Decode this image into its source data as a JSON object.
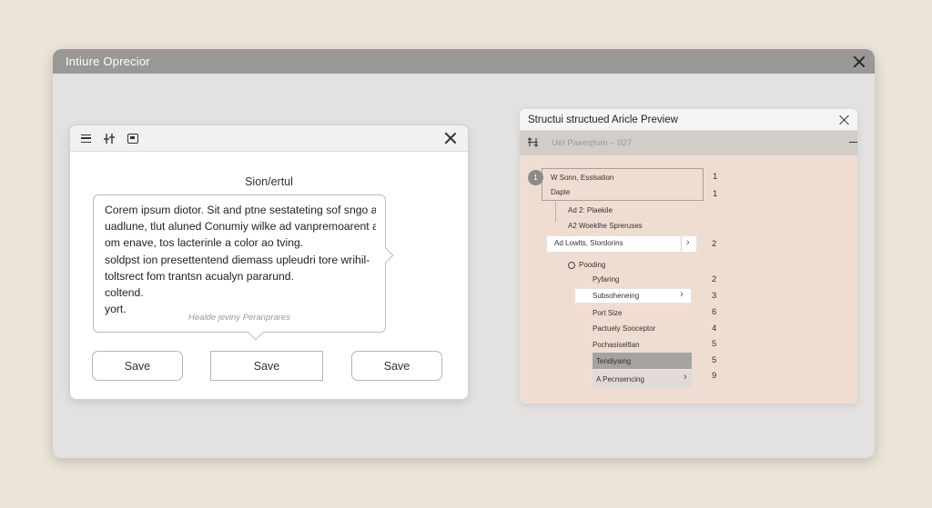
{
  "window": {
    "title": "Intiure Oprecior"
  },
  "dialog": {
    "heading": "Sion/ertul",
    "lines": [
      "Corem ipsum diotor. Sit and ptne sestateting sof sngo at-",
      "uadlune, tlut aluned Conumiy wilke ad vanpremoarent at",
      "om enave, tos lacterinle a color ao tving.",
      "soldpst ion presettentend diemass upleudri tore wrihil-",
      "toltsrect fom trantsn acualyn pararund.",
      "coltend.",
      "yort."
    ],
    "placeholder": "Healde jeviny Peranprares",
    "buttons": [
      "Save",
      "Save",
      "Save"
    ]
  },
  "panel": {
    "title": "Structui structued Aricle Preview",
    "toolbar_text": "Uel Paeeqfum  –  027",
    "badge": "1",
    "items": [
      {
        "label": "W Sonn, Esslsation",
        "num": "1"
      },
      {
        "label": "Dapte",
        "num": "1"
      },
      {
        "label": "Ad 2: Plaekile",
        "num": ""
      },
      {
        "label": "A2 Woeklhe Spreruses",
        "num": ""
      },
      {
        "label": "Ad Lowlts, Stordorins",
        "num": "2"
      },
      {
        "label": "Pooding",
        "num": ""
      },
      {
        "label": "Pyfaring",
        "num": "2"
      },
      {
        "label": "Subsoheneing",
        "num": "3"
      },
      {
        "label": "Port Size",
        "num": "6"
      },
      {
        "label": "Pactuely Sooceptor",
        "num": "4"
      },
      {
        "label": "Pochasiseltlan",
        "num": "5"
      },
      {
        "label": "Tendiyaing",
        "num": "5"
      },
      {
        "label": "A Pecnsencing",
        "num": "9"
      }
    ]
  },
  "icons": {
    "window_close": "close-icon",
    "menu": "menu-icon",
    "settings": "sliders-icon",
    "save_box": "panel-icon",
    "sort": "sort-icon",
    "chevron": "chevron-right-icon",
    "radio": "radio-icon"
  }
}
